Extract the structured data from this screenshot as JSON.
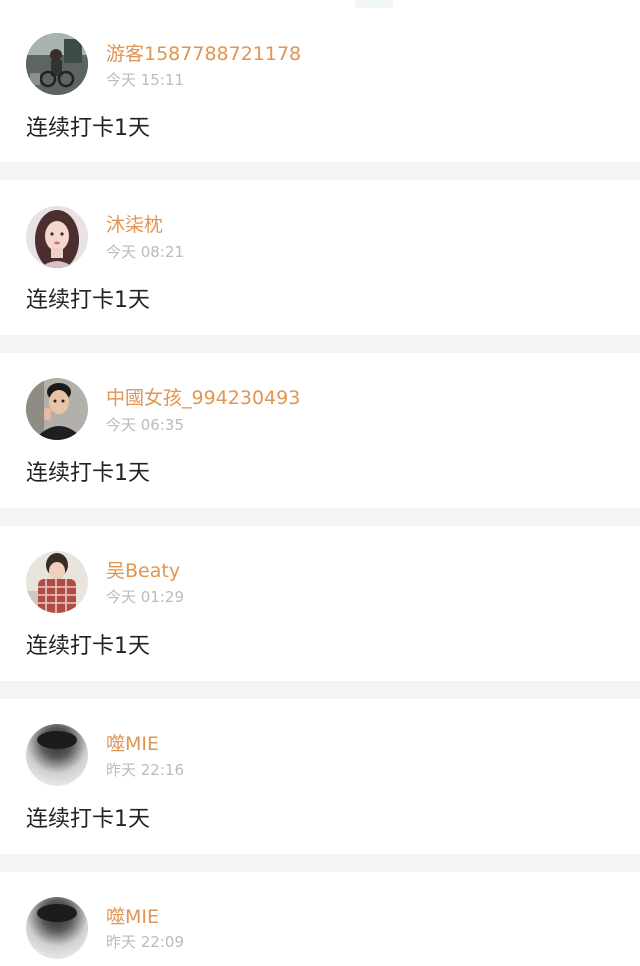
{
  "posts": [
    {
      "username": "游客1587788721178",
      "time": "今天 15:11",
      "content": "连续打卡1天",
      "avatar_icon": "street-scene-avatar-icon"
    },
    {
      "username": "沐柒枕",
      "time": "今天 08:21",
      "content": "连续打卡1天",
      "avatar_icon": "girl-portrait-avatar-icon"
    },
    {
      "username": "中國女孩_994230493",
      "time": "今天 06:35",
      "content": "连续打卡1天",
      "avatar_icon": "boy-portrait-avatar-icon"
    },
    {
      "username": "吴Beaty",
      "time": "今天 01:29",
      "content": "连续打卡1天",
      "avatar_icon": "girl-plaid-shirt-avatar-icon"
    },
    {
      "username": "噬MIE",
      "time": "昨天 22:16",
      "content": "连续打卡1天",
      "avatar_icon": "grayscale-avatar-icon"
    },
    {
      "username": "噬MIE",
      "time": "昨天 22:09",
      "avatar_icon": "grayscale-avatar-icon"
    }
  ],
  "colors": {
    "username": "#e09550",
    "timestamp": "#bbbbbb",
    "content": "#222222",
    "separator": "#f4f4f4",
    "card": "#ffffff"
  }
}
